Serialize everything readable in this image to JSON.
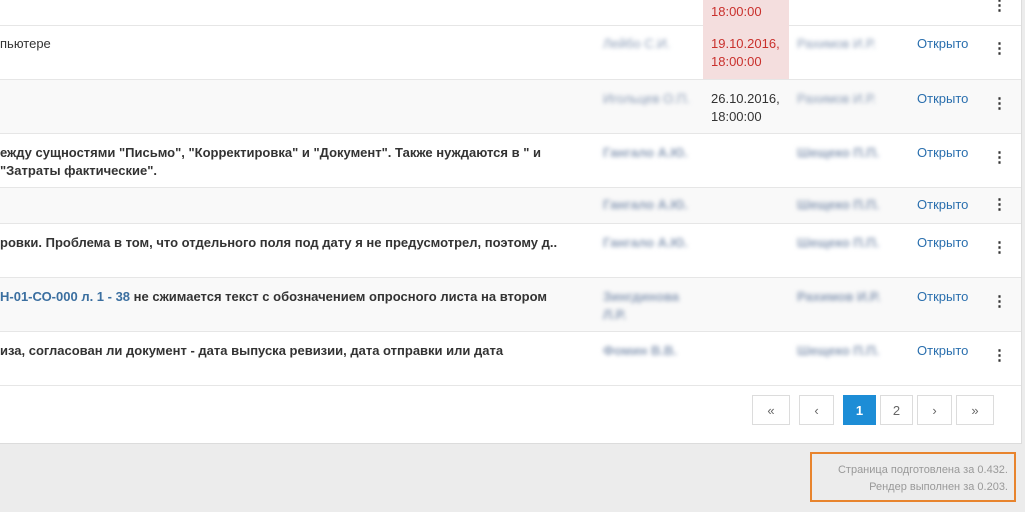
{
  "rows": [
    {
      "desc_html": "",
      "author": "",
      "date": "18:00:00",
      "executor": "",
      "status": "Открыто"
    },
    {
      "desc": "пьютере",
      "author": "Лейбо С.И.",
      "date": "19.10.2016, 18:00:00",
      "executor": "Рахимов И.Р.",
      "status": "Открыто"
    },
    {
      "desc": "",
      "author": "Игольцев О.П.",
      "date": "26.10.2016, 18:00:00",
      "executor": "Рахимов И.Р.",
      "status": "Открыто"
    },
    {
      "desc": "ежду сущностями \"Письмо\", \"Корректировка\" и \"Документ\". Также нуждаются в \" и \"Затраты фактические\".",
      "author": "Гангало А.Ю.",
      "date": "",
      "executor": "Шещеко П.П.",
      "status": "Открыто"
    },
    {
      "desc": "",
      "author": "Гангало А.Ю.",
      "date": "",
      "executor": "Шещеко П.П.",
      "status": "Открыто"
    },
    {
      "desc": "ровки. Проблема в том, что отдельного поля под дату я не предусмотрел, поэтому д..",
      "author": "Гангало А.Ю.",
      "date": "",
      "executor": "Шещеко П.П.",
      "status": "Открыто"
    },
    {
      "desc_link": "Н-01-СО-000 л. 1 - 38",
      "desc_rest": " не сжимается текст с обозначением опросного листа на втором",
      "author": "Зингдинова Л.Р.",
      "date": "",
      "executor": "Рахимов И.Р.",
      "status": "Открыто"
    },
    {
      "desc": "иза, согласован ли документ - дата выпуска ревизии, дата отправки или дата",
      "author": "Фомин В.В.",
      "date": "",
      "executor": "Шещеко П.П.",
      "status": "Открыто"
    }
  ],
  "pagination": {
    "first": "«",
    "prev": "‹",
    "pages": [
      "1",
      "2"
    ],
    "active": "1",
    "next": "›",
    "last": "»"
  },
  "footer": {
    "line1": "Страница подготовлена за 0.432.",
    "line2": "Рендер выполнен за 0.203."
  },
  "colors": {
    "link": "#2a6fae",
    "overdue_bg": "#f4dede",
    "overdue_text": "#c9302c",
    "active_page": "#1d8dd6",
    "highlight_border": "#e8842e"
  }
}
